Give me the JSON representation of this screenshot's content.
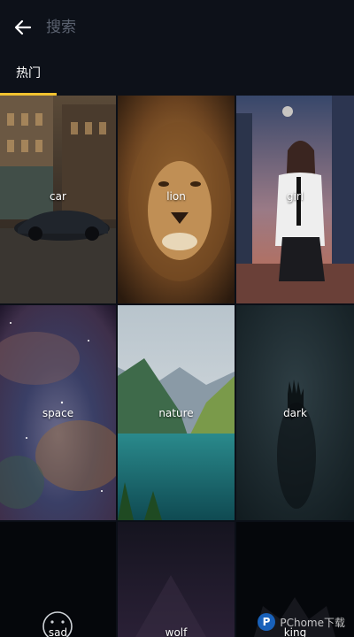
{
  "search": {
    "placeholder": "搜索"
  },
  "tabs": [
    {
      "label": "热门",
      "active": true
    }
  ],
  "accent_color": "#f2c230",
  "icons": {
    "back": "arrow-left-icon",
    "emoji": "face-icon"
  },
  "categories": [
    {
      "label": "car"
    },
    {
      "label": "lion"
    },
    {
      "label": "girl"
    },
    {
      "label": "space"
    },
    {
      "label": "nature"
    },
    {
      "label": "dark"
    },
    {
      "label": "sad"
    },
    {
      "label": "wolf"
    },
    {
      "label": "king"
    }
  ],
  "watermark": {
    "text": "PChome下载"
  }
}
